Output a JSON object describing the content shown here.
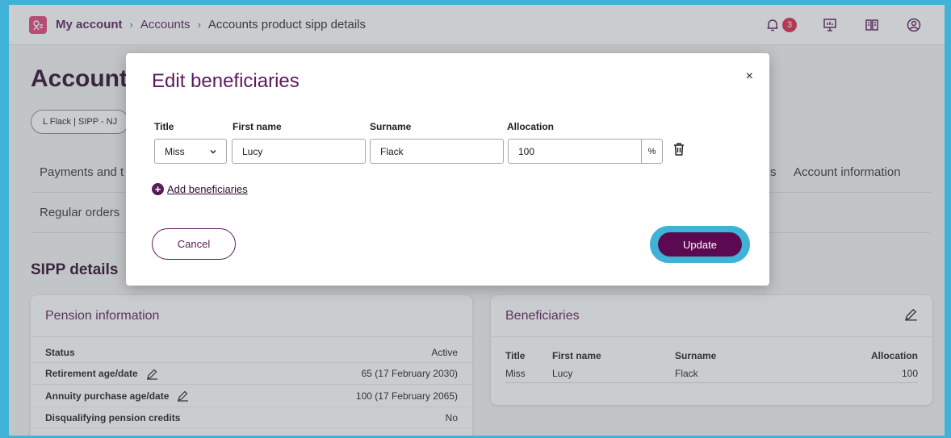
{
  "breadcrumb": {
    "home": "My account",
    "parent": "Accounts",
    "current": "Accounts product sipp details"
  },
  "topbar": {
    "notifications_count": "3"
  },
  "page": {
    "title": "Account",
    "account_pill": "L Flack | SIPP - NJ",
    "tabs": {
      "payments": "Payments and t",
      "partial": "s",
      "account_info": "Account information",
      "regular_orders": "Regular orders"
    },
    "section_title": "SIPP details"
  },
  "pension_card": {
    "title": "Pension information",
    "rows": [
      {
        "label": "Status",
        "value": "Active"
      },
      {
        "label": "Retirement age/date",
        "value": "65 (17 February 2030)"
      },
      {
        "label": "Annuity purchase age/date",
        "value": "100 (17 February 2065)"
      },
      {
        "label": "Disqualifying pension credits",
        "value": "No"
      }
    ]
  },
  "beneficiaries_card": {
    "title": "Beneficiaries",
    "headers": [
      "Title",
      "First name",
      "Surname",
      "Allocation"
    ],
    "rows": [
      [
        "Miss",
        "Lucy",
        "Flack",
        "100"
      ]
    ]
  },
  "modal": {
    "title": "Edit beneficiaries",
    "close": "×",
    "labels": {
      "title": "Title",
      "first_name": "First name",
      "surname": "Surname",
      "allocation": "Allocation"
    },
    "values": {
      "title": "Miss",
      "first_name": "Lucy",
      "surname": "Flack",
      "allocation": "100"
    },
    "percent_unit": "%",
    "add_link": "Add beneficiaries",
    "cancel": "Cancel",
    "update": "Update"
  }
}
